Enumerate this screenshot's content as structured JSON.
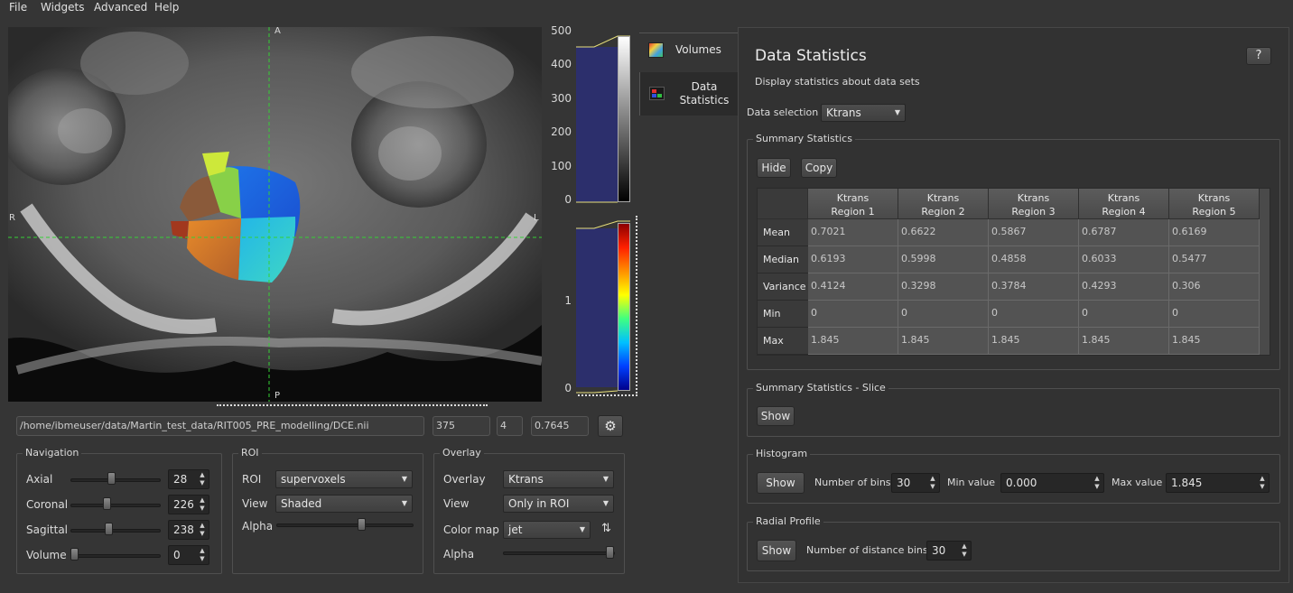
{
  "menubar": {
    "items": [
      {
        "label": "File"
      },
      {
        "label": "Widgets"
      },
      {
        "label": "Advanced"
      },
      {
        "label": "Help"
      }
    ]
  },
  "viewer": {
    "orientation": {
      "top": "A",
      "bottom": "P",
      "left": "R",
      "right": "L"
    },
    "crosshair_color": "#35d035"
  },
  "colorbars": {
    "volume_ticks": [
      "500",
      "400",
      "300",
      "200",
      "100",
      "0"
    ],
    "overlay_ticks": [
      "1",
      "0"
    ],
    "overlay_colormap": "jet"
  },
  "file_bar": {
    "path": "/home/ibmeuser/data/Martin_test_data/RIT005_PRE_modelling/DCE.nii",
    "index": "375",
    "volume": "4",
    "value": "0.7645",
    "settings_icon": "gear-icon"
  },
  "navigation": {
    "title": "Navigation",
    "rows": [
      {
        "label": "Axial",
        "value": "28",
        "level": 0.45
      },
      {
        "label": "Coronal",
        "value": "226",
        "level": 0.4
      },
      {
        "label": "Sagittal",
        "value": "238",
        "level": 0.42
      },
      {
        "label": "Volume",
        "value": "0",
        "level": 0.0
      }
    ]
  },
  "roi": {
    "title": "ROI",
    "roi_label": "ROI",
    "roi_value": "supervoxels",
    "view_label": "View",
    "view_value": "Shaded",
    "alpha_label": "Alpha",
    "alpha_level": 0.63
  },
  "overlay": {
    "title": "Overlay",
    "overlay_label": "Overlay",
    "overlay_value": "Ktrans",
    "view_label": "View",
    "view_value": "Only in ROI",
    "colormap_label": "Color map",
    "colormap_value": "jet",
    "colormap_icon": "levels-icon",
    "alpha_label": "Alpha",
    "alpha_level": 1.0
  },
  "side_tabs": [
    {
      "label": "Volumes",
      "icon": "volumes-icon"
    },
    {
      "label": "Data\nStatistics",
      "icon": "statistics-icon"
    }
  ],
  "panel": {
    "title": "Data Statistics",
    "help_label": "?",
    "description": "Display statistics about data sets",
    "data_selection_label": "Data selection",
    "data_selection_value": "Ktrans",
    "summary": {
      "title": "Summary Statistics",
      "hide_label": "Hide",
      "copy_label": "Copy",
      "columns": [
        "Ktrans\nRegion 1",
        "Ktrans\nRegion 2",
        "Ktrans\nRegion 3",
        "Ktrans\nRegion 4",
        "Ktrans\nRegion 5"
      ],
      "rows": [
        {
          "label": "Mean",
          "values": [
            "0.7021",
            "0.6622",
            "0.5867",
            "0.6787",
            "0.6169"
          ]
        },
        {
          "label": "Median",
          "values": [
            "0.6193",
            "0.5998",
            "0.4858",
            "0.6033",
            "0.5477"
          ]
        },
        {
          "label": "Variance",
          "values": [
            "0.4124",
            "0.3298",
            "0.3784",
            "0.4293",
            "0.306"
          ]
        },
        {
          "label": "Min",
          "values": [
            "0",
            "0",
            "0",
            "0",
            "0"
          ]
        },
        {
          "label": "Max",
          "values": [
            "1.845",
            "1.845",
            "1.845",
            "1.845",
            "1.845"
          ]
        }
      ]
    },
    "summary_slice": {
      "title": "Summary Statistics - Slice",
      "show_label": "Show"
    },
    "histogram": {
      "title": "Histogram",
      "show_label": "Show",
      "bins_label": "Number of bins",
      "bins_value": "30",
      "min_label": "Min value",
      "min_value": "0.000",
      "max_label": "Max value",
      "max_value": "1.845"
    },
    "radial": {
      "title": "Radial Profile",
      "show_label": "Show",
      "bins_label": "Number of distance bins",
      "bins_value": "30"
    }
  }
}
